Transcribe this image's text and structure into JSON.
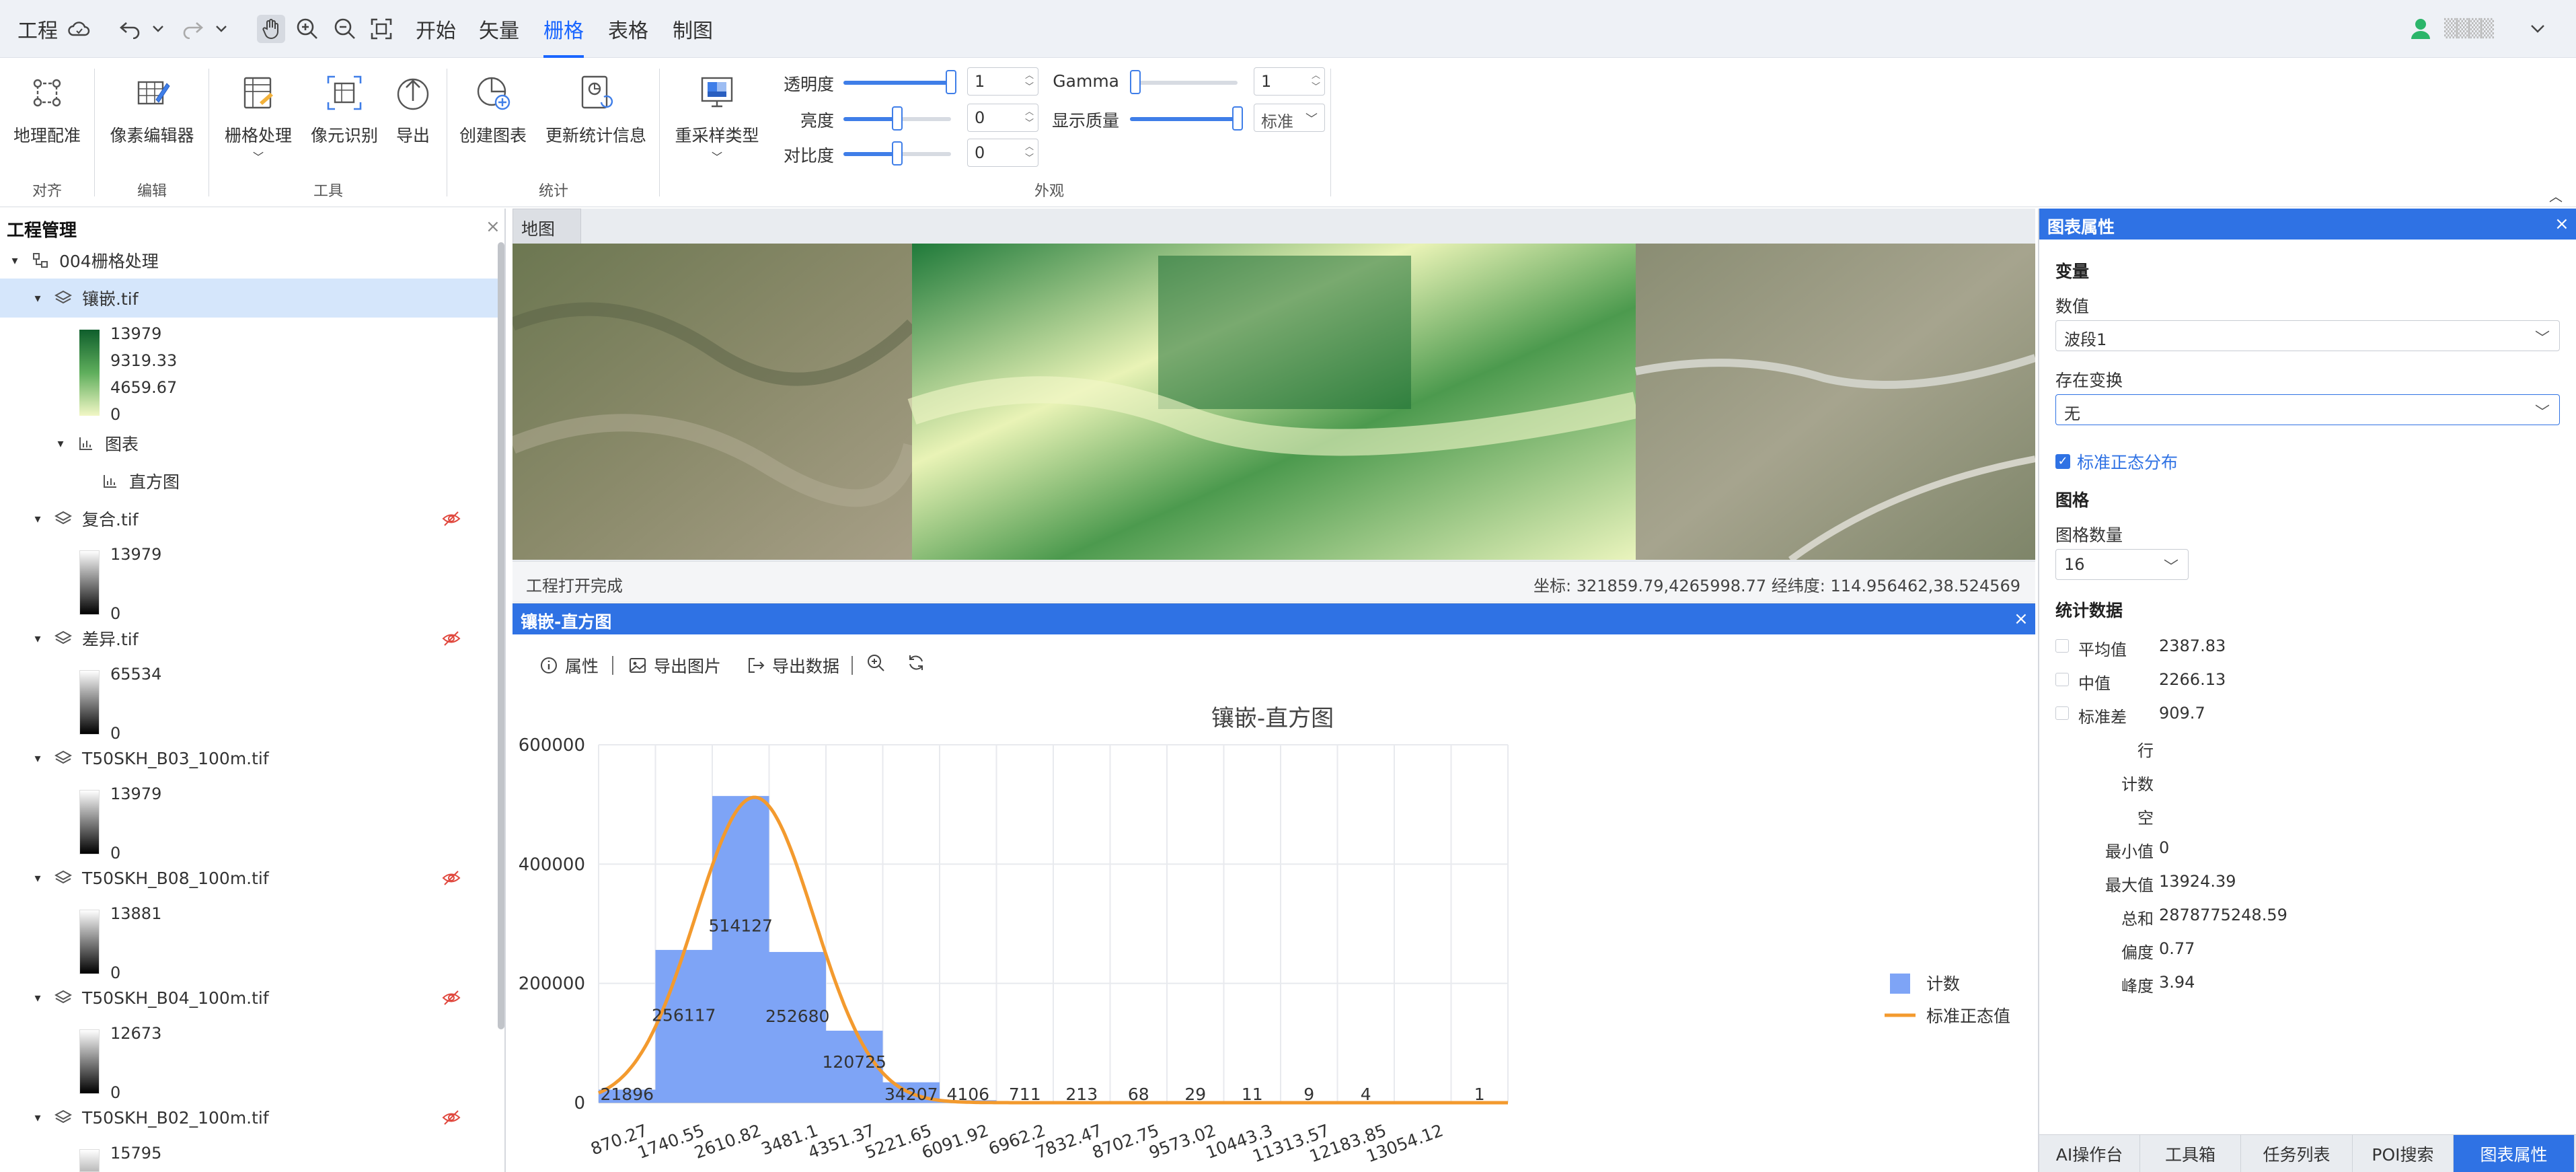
{
  "menubar": {
    "project": "工程",
    "tabs": [
      {
        "label": "开始"
      },
      {
        "label": "矢量"
      },
      {
        "label": "栅格",
        "active": true
      },
      {
        "label": "表格"
      },
      {
        "label": "制图"
      }
    ],
    "username": "▒▒▒▒"
  },
  "ribbon": {
    "buttons": {
      "georeference": "地理配准",
      "pixel_editor": "像素编辑器",
      "raster_processing": "栅格处理",
      "pixel_recognition": "像元识别",
      "export": "导出",
      "create_chart": "创建图表",
      "update_stats": "更新统计信息",
      "resample": "重采样类型"
    },
    "groups": {
      "align": "对齐",
      "edit": "编辑",
      "tools": "工具",
      "stats": "统计",
      "appearance": "外观"
    },
    "controls": {
      "transparency": {
        "label": "透明度",
        "value": "1",
        "level": 1.0
      },
      "brightness": {
        "label": "亮度",
        "value": "0",
        "level": 0.5
      },
      "contrast": {
        "label": "对比度",
        "value": "0",
        "level": 0.5
      },
      "gamma": {
        "label": "Gamma",
        "value": "1",
        "level": 0.05
      },
      "display_quality": {
        "label": "显示质量",
        "value": "标准",
        "level": 1.0
      }
    }
  },
  "left_panel": {
    "title": "工程管理",
    "project_name": "004栅格处理",
    "layers": {
      "mosaic": {
        "name": "镶嵌.tif",
        "legend": [
          "13979",
          "9319.33",
          "4659.67",
          "0"
        ],
        "chart_folder": "图表",
        "chart_item": "直方图"
      },
      "composite": {
        "name": "复合.tif",
        "legend_max": "13979",
        "legend_min": "0"
      },
      "difference": {
        "name": "差异.tif",
        "legend_max": "65534",
        "legend_min": "0"
      },
      "b03": {
        "name": "T50SKH_B03_100m.tif",
        "legend_max": "13979",
        "legend_min": "0"
      },
      "b08": {
        "name": "T50SKH_B08_100m.tif",
        "legend_max": "13881",
        "legend_min": "0"
      },
      "b04": {
        "name": "T50SKH_B04_100m.tif",
        "legend_max": "12673",
        "legend_min": "0"
      },
      "b02": {
        "name": "T50SKH_B02_100m.tif",
        "legend_max": "15795"
      }
    }
  },
  "map": {
    "tab": "地图",
    "status_left": "工程打开完成",
    "status_right": "坐标: 321859.79,4265998.77 经纬度: 114.956462,38.524569"
  },
  "histogram_panel": {
    "title": "镶嵌-直方图",
    "toolbar": {
      "properties": "属性",
      "export_image": "导出图片",
      "export_data": "导出数据"
    }
  },
  "chart_data": {
    "type": "bar",
    "title": "镶嵌-直方图",
    "categories": [
      "870.27",
      "1740.55",
      "2610.82",
      "3481.1",
      "4351.37",
      "5221.65",
      "6091.92",
      "6962.2",
      "7832.47",
      "8702.75",
      "9573.02",
      "10443.3",
      "11313.57",
      "12183.85",
      "13054.12"
    ],
    "yticks": [
      "0",
      "200000",
      "400000",
      "600000"
    ],
    "ylim": [
      0,
      600000
    ],
    "series": [
      {
        "name": "计数",
        "type": "bar",
        "color": "#7ea4f6",
        "values": [
          21896,
          256117,
          514127,
          252680,
          120725,
          34207,
          4106,
          711,
          213,
          68,
          29,
          11,
          9,
          4,
          0,
          1
        ],
        "labels": [
          "21896",
          "256117",
          "514127",
          "252680",
          "120725",
          "34207",
          "4106",
          "711",
          "213",
          "68",
          "29",
          "11",
          "9",
          "4",
          "",
          "1"
        ]
      },
      {
        "name": "标准正态值",
        "type": "line",
        "color": "#f39a2e",
        "mean": 2387.83,
        "std": 909.7,
        "peak": 512000
      }
    ],
    "xlim": [
      0,
      13924.39
    ],
    "legend_position": "right",
    "grid": true
  },
  "right_panel": {
    "title": "图表属性",
    "variable_heading": "变量",
    "value_label": "数值",
    "value_select": "波段1",
    "transform_label": "存在变换",
    "transform_select": "无",
    "std_normal_label": "标准正态分布",
    "grid_heading": "图格",
    "grid_count_label": "图格数量",
    "grid_count_value": "16",
    "stats_heading": "统计数据",
    "stats": [
      {
        "label": "平均值",
        "value": "2387.83",
        "checkbox": true
      },
      {
        "label": "中值",
        "value": "2266.13",
        "checkbox": true
      },
      {
        "label": "标准差",
        "value": "909.7",
        "checkbox": true
      },
      {
        "label": "行",
        "value": ""
      },
      {
        "label": "计数",
        "value": ""
      },
      {
        "label": "空",
        "value": ""
      },
      {
        "label": "最小值",
        "value": "0"
      },
      {
        "label": "最大值",
        "value": "13924.39"
      },
      {
        "label": "总和",
        "value": "2878775248.59"
      },
      {
        "label": "偏度",
        "value": "0.77"
      },
      {
        "label": "峰度",
        "value": "3.94"
      }
    ],
    "bottom_tabs": [
      "AI操作台",
      "工具箱",
      "任务列表",
      "POI搜索",
      "图表属性"
    ]
  },
  "colors": {
    "accent": "#1a66ff",
    "panel_title_blue": "#2f72e4",
    "bar": "#7ea4f6",
    "curve": "#f39a2e"
  }
}
